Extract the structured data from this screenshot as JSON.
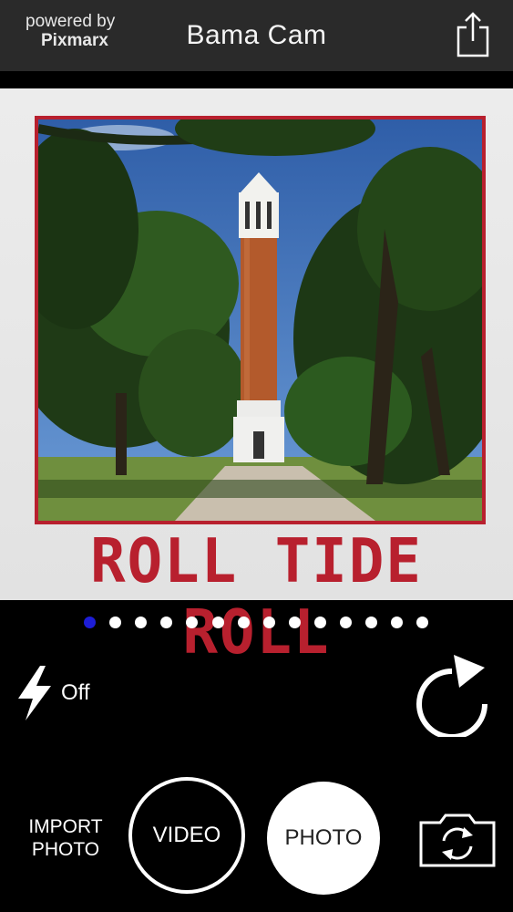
{
  "header": {
    "powered_line1": "powered by",
    "powered_line2": "Pixmarx",
    "title": "Bama Cam",
    "share_icon": "share-icon"
  },
  "frame": {
    "caption": "ROLL TIDE ROLL",
    "border_color": "#b8202e",
    "caption_color": "#b8202e"
  },
  "pager": {
    "total": 14,
    "active_index": 0,
    "active_color": "#1d1dd6"
  },
  "controls": {
    "flash_icon": "flash-icon",
    "flash_state": "Off",
    "rotate_icon": "rotate-icon",
    "import_label_line1": "IMPORT",
    "import_label_line2": "PHOTO",
    "video_label": "VIDEO",
    "photo_label": "PHOTO",
    "switch_camera_icon": "switch-camera-icon"
  }
}
